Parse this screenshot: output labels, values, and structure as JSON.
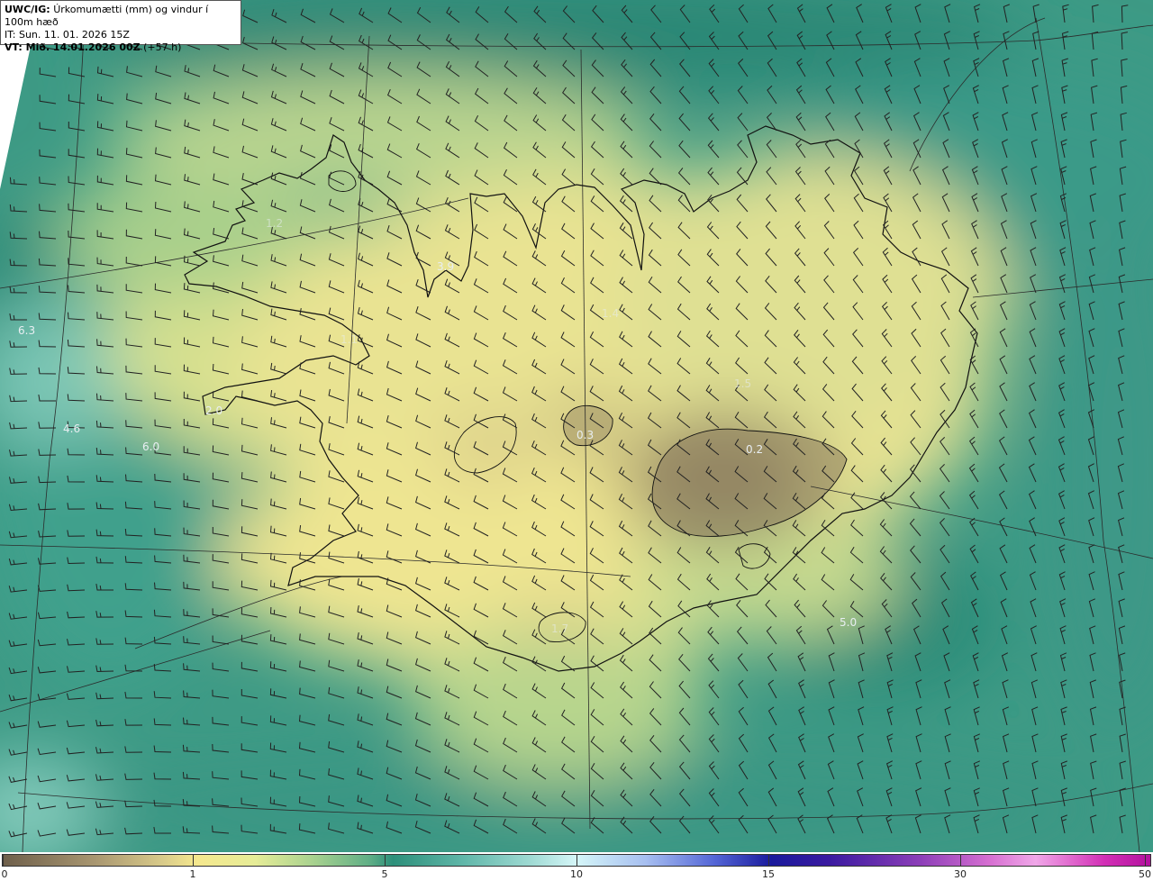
{
  "header": {
    "model_tag": "UWC/IG:",
    "title": "Úrkomumætti (mm) og vindur í 100m hæð",
    "init_time": "IT: Sun. 11. 01. 2026 15Z",
    "valid_prefix": "VT: Mið. 14.01.2026 00Z",
    "valid_suffix": "(+57 h)"
  },
  "map_labels": [
    {
      "text": "6.3"
    },
    {
      "text": "4.6"
    },
    {
      "text": "6.0"
    },
    {
      "text": "3.9"
    },
    {
      "text": "2.0"
    },
    {
      "text": "0.3"
    },
    {
      "text": "0.2"
    },
    {
      "text": "5.0"
    },
    {
      "text": "1.2"
    },
    {
      "text": "1.4"
    },
    {
      "text": "1.5"
    },
    {
      "text": "1.1"
    },
    {
      "text": "1.7"
    }
  ],
  "colorbar": {
    "ticks": [
      {
        "label": "0",
        "value": 0
      },
      {
        "label": "1",
        "value": 1
      },
      {
        "label": "5",
        "value": 5
      },
      {
        "label": "10",
        "value": 10
      },
      {
        "label": "15",
        "value": 15
      },
      {
        "label": "30",
        "value": 30
      },
      {
        "label": "50",
        "value": 50
      }
    ],
    "unit": "mm"
  },
  "colors": {
    "dry": "#7a6a50",
    "low": "#f2e58f",
    "medium": "#2d8f7a",
    "high": "#9fdad3",
    "coastline": "#111111",
    "barb": "#222222"
  }
}
